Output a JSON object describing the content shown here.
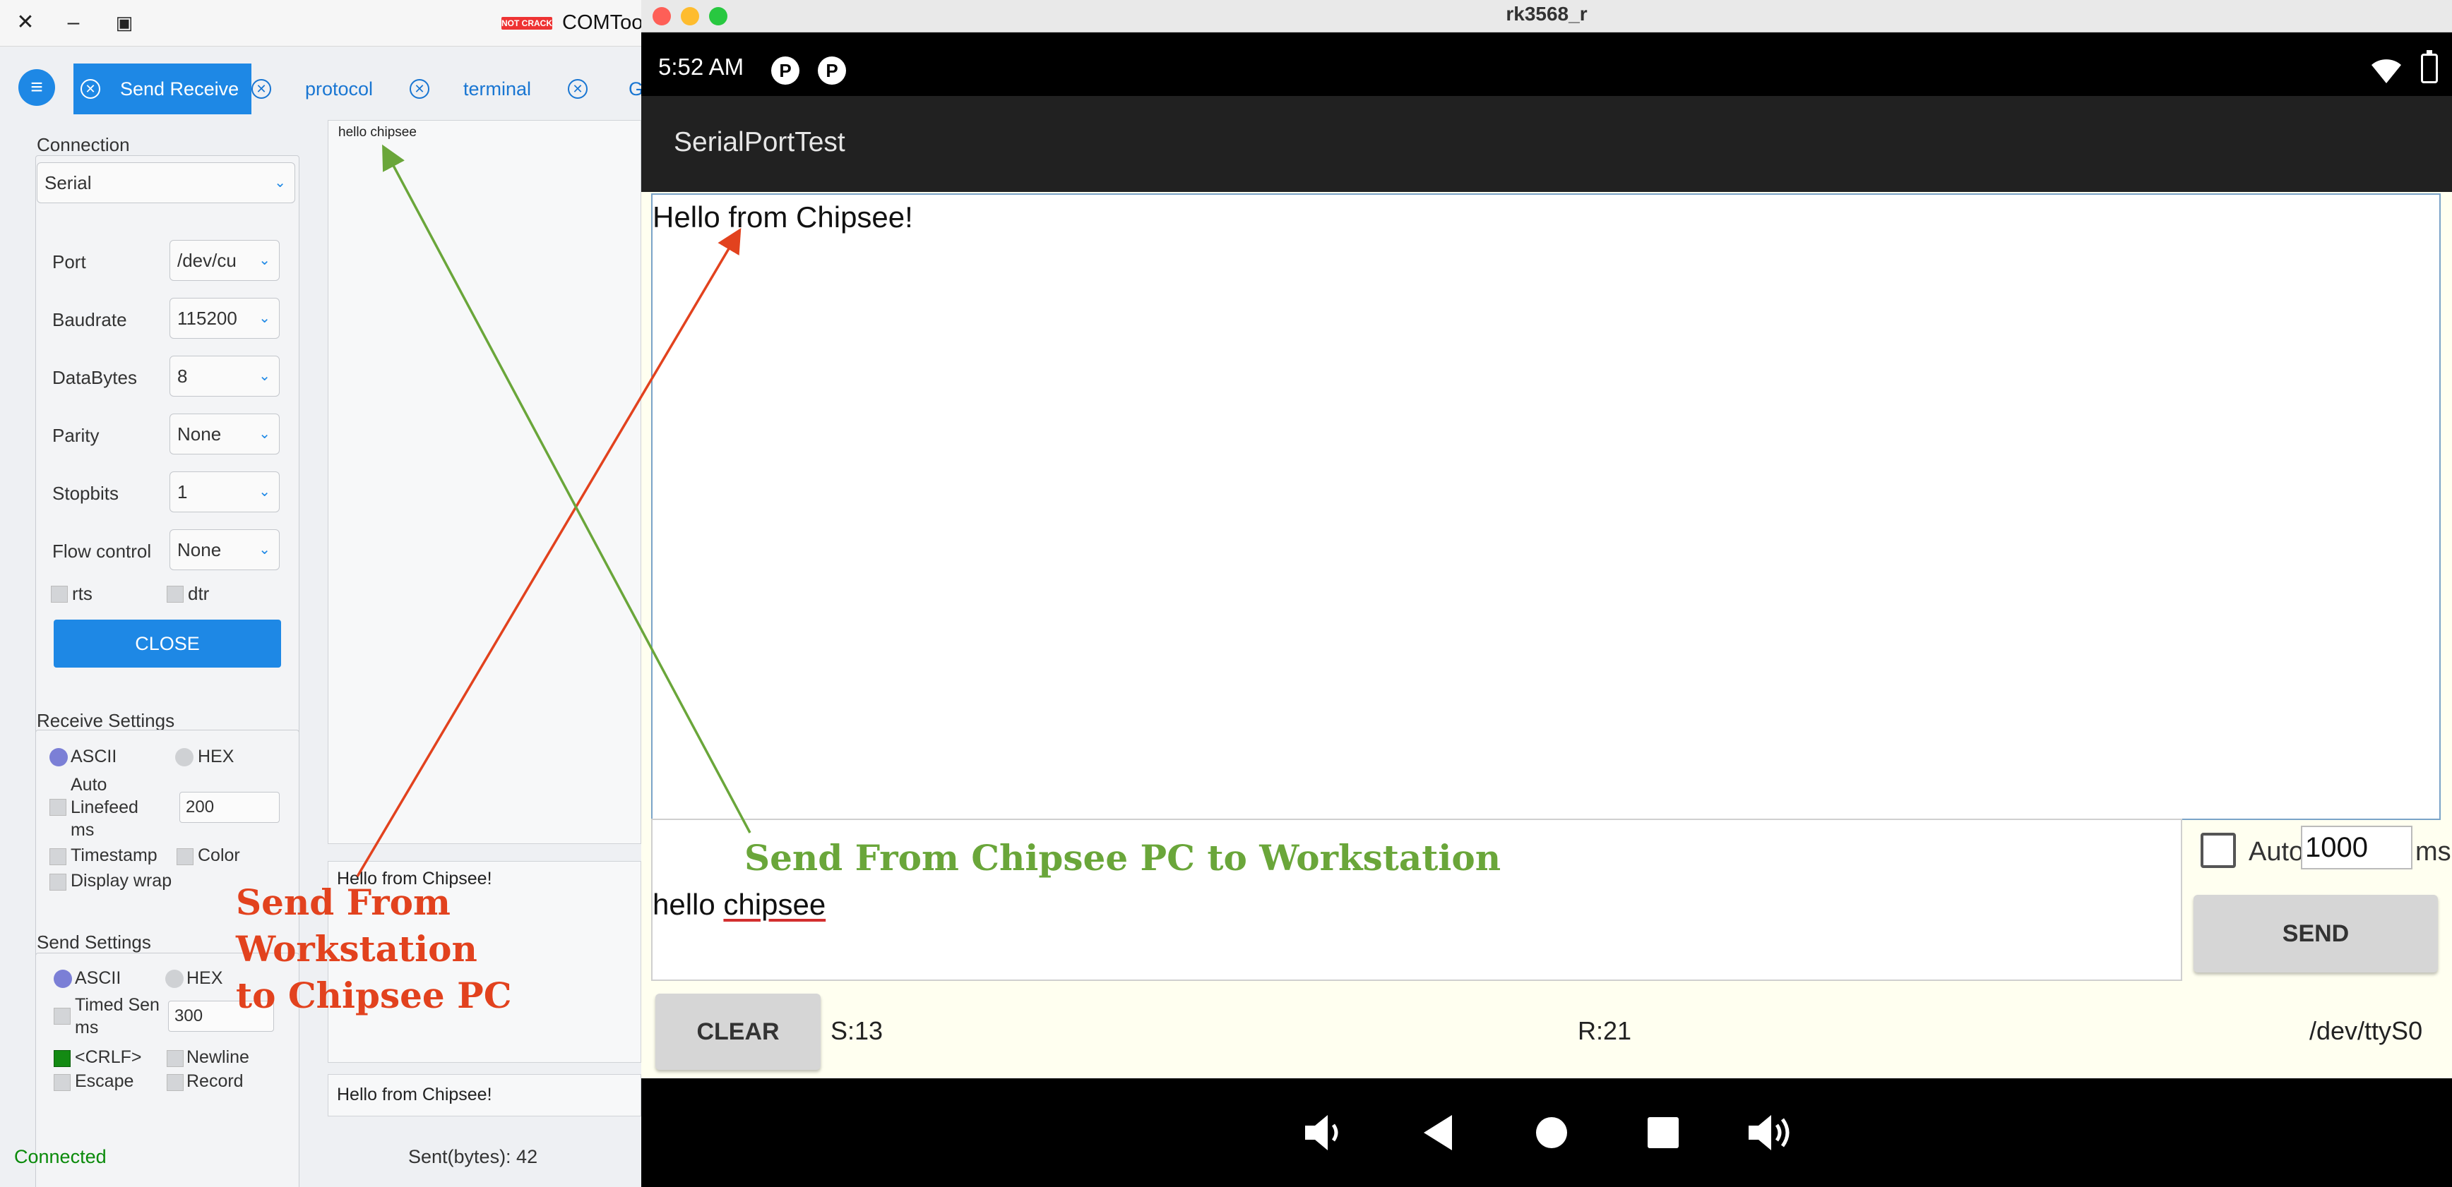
{
  "comtool": {
    "title": "COMTool",
    "logo_text": "NOT CRACK",
    "tabs": [
      {
        "label": "Send Receive"
      },
      {
        "label": "protocol"
      },
      {
        "label": "terminal"
      },
      {
        "label": "G"
      }
    ],
    "connection": {
      "section_title": "Connection",
      "type": "Serial",
      "port_label": "Port",
      "port_value": "/dev/cu",
      "baudrate_label": "Baudrate",
      "baudrate_value": "115200",
      "databytes_label": "DataBytes",
      "databytes_value": "8",
      "parity_label": "Parity",
      "parity_value": "None",
      "stopbits_label": "Stopbits",
      "stopbits_value": "1",
      "flow_label": "Flow control",
      "flow_value": "None",
      "rts_label": "rts",
      "dtr_label": "dtr",
      "close_label": "CLOSE"
    },
    "receive_settings": {
      "section_title": "Receive Settings",
      "ascii_label": "ASCII",
      "hex_label": "HEX",
      "auto_linefeed_label_1": "Auto",
      "auto_linefeed_label_2": "Linefeed",
      "auto_linefeed_label_3": "ms",
      "auto_linefeed_value": "200",
      "timestamp_label": "Timestamp",
      "color_label": "Color",
      "display_wrap_label": "Display wrap"
    },
    "send_settings": {
      "section_title": "Send Settings",
      "ascii_label": "ASCII",
      "hex_label": "HEX",
      "timed_send_label_1": "Timed Sen",
      "timed_send_label_2": "ms",
      "timed_send_value": "300",
      "crlf_label": "<CRLF>",
      "newline_label": "Newline",
      "escape_label": "Escape",
      "record_label": "Record"
    },
    "receive_text": "hello chipsee",
    "send_text": "Hello from Chipsee!",
    "send_history": "Hello from Chipsee!",
    "status": {
      "connection": "Connected",
      "sent": "Sent(bytes): 42"
    }
  },
  "emulator": {
    "window_title": "rk3568_r",
    "time": "5:52 AM",
    "app_title": "SerialPortTest",
    "received_text": "Hello from Chipsee!",
    "send_text_word1": "hello",
    "send_text_word2": "chipsee",
    "auto_label": "Auto",
    "auto_interval": "1000",
    "ms_label": "ms",
    "send_label": "SEND",
    "clear_label": "CLEAR",
    "sent_count": "S:13",
    "recv_count": "R:21",
    "device": "/dev/ttyS0"
  },
  "annotations": {
    "red": [
      "Send From",
      "Workstation",
      "to Chipsee PC"
    ],
    "green": "Send From Chipsee PC to Workstation",
    "red_color": "#e2421e",
    "green_color": "#6aa63a"
  },
  "colors": {
    "accent": "#1e88e5",
    "connected": "#0a8a0a",
    "android_bg": "#fffff0"
  }
}
